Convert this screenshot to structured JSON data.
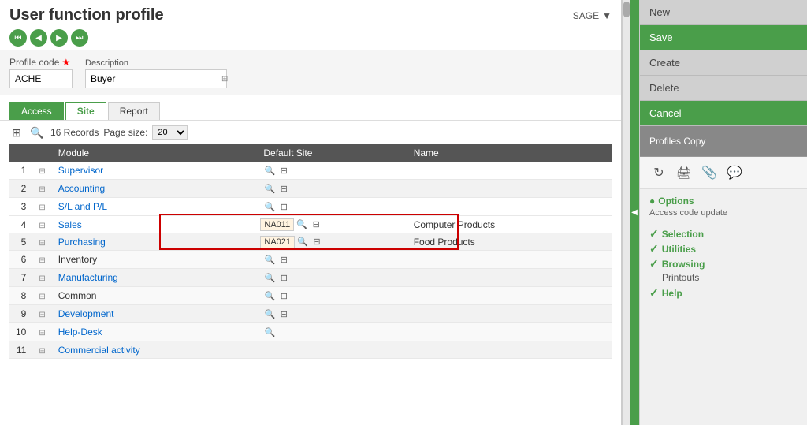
{
  "header": {
    "title": "User function profile",
    "sage_label": "SAGE",
    "nav_buttons": [
      "◄",
      "◀",
      "▶",
      "►"
    ]
  },
  "form": {
    "profile_code_label": "Profile code",
    "required_star": "★",
    "description_label": "Description",
    "profile_code_value": "ACHE",
    "description_value": "Buyer"
  },
  "tabs": [
    {
      "label": "Access",
      "state": "active-green"
    },
    {
      "label": "Site",
      "state": "active-white"
    },
    {
      "label": "Report",
      "state": "inactive"
    }
  ],
  "table": {
    "records_label": "16 Records",
    "page_size_label": "Page size:",
    "page_size_value": "20",
    "columns": [
      "",
      "Module",
      "Default Site",
      "Name"
    ],
    "rows": [
      {
        "num": 1,
        "module": "Supervisor",
        "site": "",
        "name": "",
        "highlighted": false
      },
      {
        "num": 2,
        "module": "Accounting",
        "site": "",
        "name": "",
        "highlighted": false
      },
      {
        "num": 3,
        "module": "S/L and P/L",
        "site": "",
        "name": "",
        "highlighted": false
      },
      {
        "num": 4,
        "module": "Sales",
        "site": "NA011",
        "name": "Computer Products",
        "highlighted": true
      },
      {
        "num": 5,
        "module": "Purchasing",
        "site": "NA021",
        "name": "Food Products",
        "highlighted": true
      },
      {
        "num": 6,
        "module": "Inventory",
        "site": "",
        "name": "",
        "highlighted": false
      },
      {
        "num": 7,
        "module": "Manufacturing",
        "site": "",
        "name": "",
        "highlighted": false
      },
      {
        "num": 8,
        "module": "Common",
        "site": "",
        "name": "",
        "highlighted": false
      },
      {
        "num": 9,
        "module": "Development",
        "site": "",
        "name": "",
        "highlighted": false
      },
      {
        "num": 10,
        "module": "Help-Desk",
        "site": "",
        "name": "",
        "highlighted": false
      },
      {
        "num": 11,
        "module": "Commercial activity",
        "site": "",
        "name": "",
        "highlighted": false
      }
    ]
  },
  "sidebar": {
    "buttons": [
      {
        "label": "New",
        "style": "gray"
      },
      {
        "label": "Save",
        "style": "green"
      },
      {
        "label": "Create",
        "style": "gray"
      },
      {
        "label": "Delete",
        "style": "gray"
      },
      {
        "label": "Cancel",
        "style": "green"
      }
    ],
    "profiles_copy_label": "Profiles Copy",
    "icons": [
      "↻",
      "🖨",
      "📎",
      "💬"
    ],
    "options_label": "Options",
    "options_subtitle": "Access code update",
    "links": [
      {
        "label": "Selection",
        "icon": "✓"
      },
      {
        "label": "Utilities",
        "icon": "✓"
      },
      {
        "label": "Browsing",
        "icon": "✓"
      },
      {
        "label": "Printouts",
        "style": "sub"
      },
      {
        "label": "Help",
        "icon": "✓"
      }
    ]
  }
}
